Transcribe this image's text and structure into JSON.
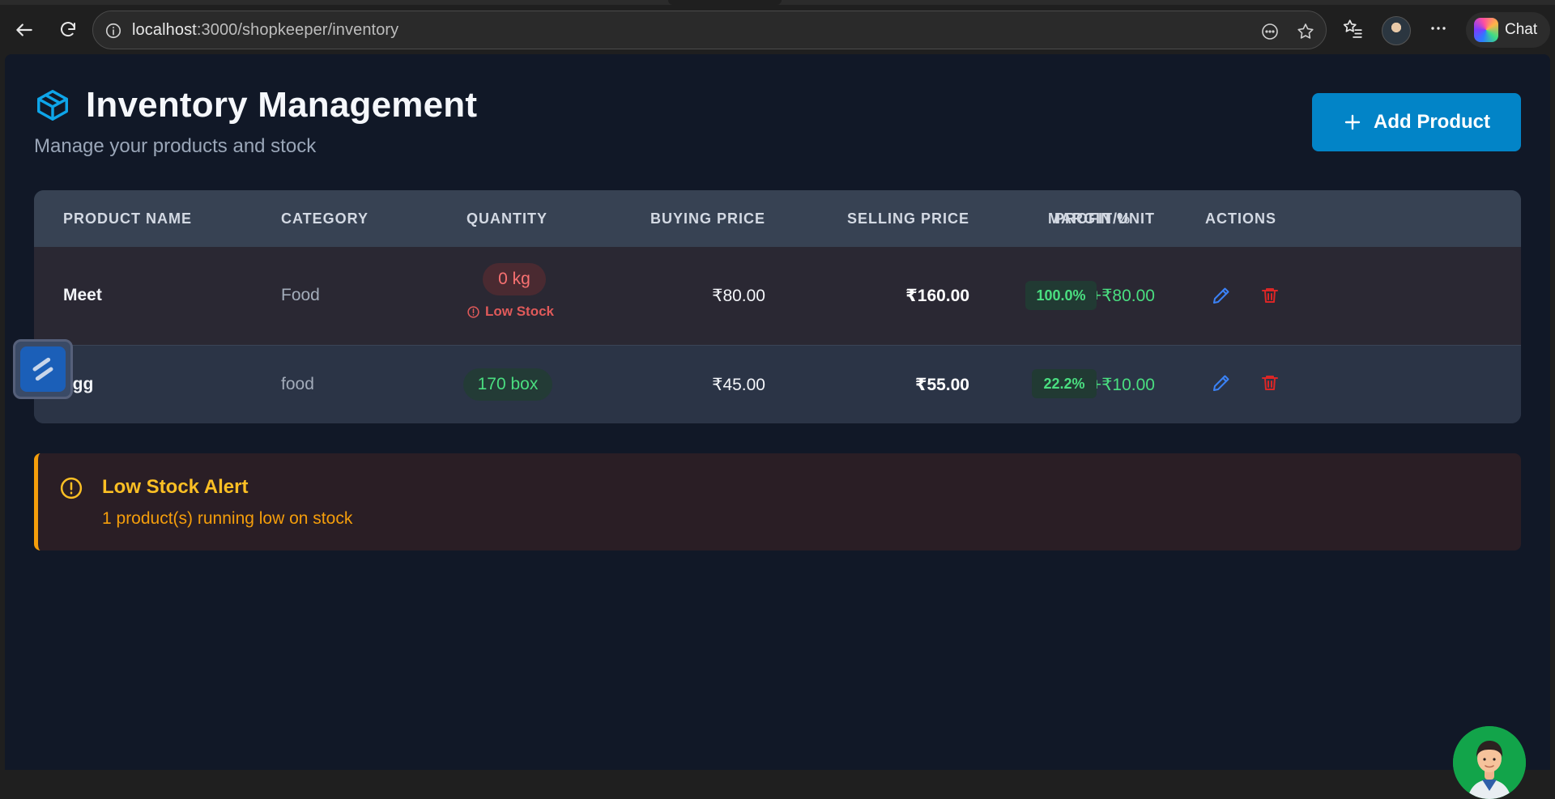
{
  "browser": {
    "url_host": "localhost",
    "url_path": ":3000/shopkeeper/inventory",
    "chat_label": "Chat"
  },
  "header": {
    "title": "Inventory Management",
    "subtitle": "Manage your products and stock",
    "add_button_label": "Add Product"
  },
  "table": {
    "columns": [
      "PRODUCT NAME",
      "CATEGORY",
      "QUANTITY",
      "BUYING PRICE",
      "SELLING PRICE",
      "PROFIT/UNIT",
      "MARGIN %",
      "ACTIONS"
    ],
    "rows": [
      {
        "name": "Meet",
        "category": "Food",
        "quantity": "0 kg",
        "low_stock_label": "Low Stock",
        "buying_price": "₹80.00",
        "selling_price": "₹160.00",
        "profit": "+₹80.00",
        "margin": "100.0%"
      },
      {
        "name": "egg",
        "category": "food",
        "quantity": "170 box",
        "buying_price": "₹45.00",
        "selling_price": "₹55.00",
        "profit": "+₹10.00",
        "margin": "22.2%"
      }
    ]
  },
  "alert": {
    "title": "Low Stock Alert",
    "message": "1 product(s) running low on stock"
  },
  "colors": {
    "accent": "#0284c7",
    "page_bg": "#111827",
    "success": "#4ade80",
    "danger": "#f87171",
    "warning": "#f59e0b"
  }
}
